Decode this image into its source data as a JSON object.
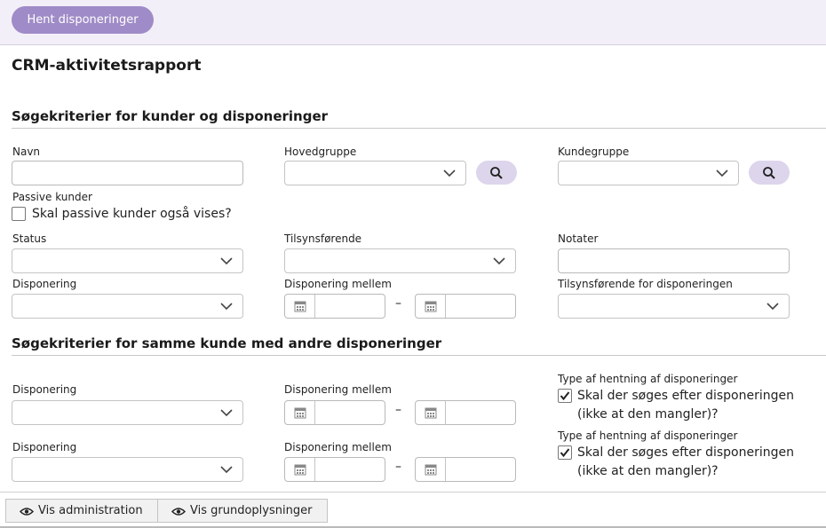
{
  "toolbar": {
    "fetch_label": "Hent disponeringer"
  },
  "page_title": "CRM-aktivitetsrapport",
  "section1": {
    "title": "Søgekriterier for kunder og disponeringer",
    "navn_label": "Navn",
    "hovedgruppe_label": "Hovedgruppe",
    "kundegruppe_label": "Kundegruppe",
    "passive_label": "Passive kunder",
    "passive_checkbox_text": "Skal passive kunder også vises?",
    "passive_checked": false,
    "status_label": "Status",
    "tilsyn_label": "Tilsynsførende",
    "notater_label": "Notater",
    "disponering_label": "Disponering",
    "disponering_mellem_label": "Disponering mellem",
    "tilsyn_disp_label": "Tilsynsførende for disponeringen"
  },
  "section2": {
    "title": "Søgekriterier for samme kunde med andre disponeringer",
    "rows": [
      {
        "disponering_label": "Disponering",
        "mellem_label": "Disponering mellem",
        "type_label": "Type af hentning af disponeringer",
        "checkbox_text_1": "Skal der søges efter disponeringen",
        "checkbox_text_2": "(ikke at den mangler)?",
        "checked": true
      },
      {
        "disponering_label": "Disponering",
        "mellem_label": "Disponering mellem",
        "type_label": "Type af hentning af disponeringer",
        "checkbox_text_1": "Skal der søges efter disponeringen",
        "checkbox_text_2": "(ikke at den mangler)?",
        "checked": true
      }
    ]
  },
  "range_separator": "–",
  "footer": {
    "vis_admin_label": "Vis administration",
    "vis_grund_label": "Vis grundoplysninger"
  },
  "icons": {
    "search": "search-icon",
    "chevron": "chevron-down-icon",
    "calendar": "calendar-icon",
    "eye": "eye-icon",
    "check": "check-icon"
  },
  "colors": {
    "accent": "#9f8bc7",
    "accent_light": "#ddd5ec",
    "topbar_bg": "#f3eff8"
  }
}
